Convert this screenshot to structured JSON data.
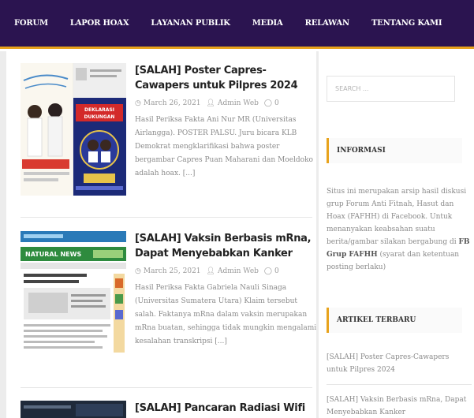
{
  "nav": {
    "items": [
      "FORUM",
      "LAPOR HOAX",
      "LAYANAN PUBLIK",
      "MEDIA",
      "RELAWAN",
      "TENTANG KAMI"
    ]
  },
  "posts": [
    {
      "title": "[SALAH] Poster Capres-Cawapers untuk Pilpres 2024",
      "date": "March 26, 2021",
      "author": "Admin Web",
      "comments": "0",
      "excerpt": "Hasil Periksa Fakta Ani Nur MR (Universitas Airlangga). POSTER PALSU. Juru bicara KLB Demokrat mengklarifikasi bahwa poster bergambar Capres Puan Maharani dan Moeldoko adalah hoax. [...]",
      "thumb_text": "DEKLARASI DUKUNGAN"
    },
    {
      "title": "[SALAH] Vaksin Berbasis mRna, Dapat Menyebabkan Kanker",
      "date": "March 25, 2021",
      "author": "Admin Web",
      "comments": "0",
      "excerpt": "Hasil Periksa Fakta Gabriela Nauli Sinaga (Universitas Sumatera Utara) Klaim tersebut salah. Faktanya mRna dalam vaksin merupakan mRna buatan, sehingga tidak mungkin mengalami kesalahan transkripsi [...]",
      "thumb_text": "NATURAL NEWS"
    },
    {
      "title": "[SALAH] Pancaran Radiasi Wifi Berakibat"
    }
  ],
  "sidebar": {
    "search_placeholder": "SEARCH ...",
    "info_title": "INFORMASI",
    "info_text_1": "Situs ini merupakan arsip hasil diskusi grup Forum Anti Fitnah, Hasut dan Hoax (FAFHH) di Facebook. Untuk menanyakan keabsahan suatu berita/gambar silakan bergabung di ",
    "info_text_bold": "FB Grup FAFHH",
    "info_text_2": " (syarat dan ketentuan posting berlaku)",
    "latest_title": "ARTIKEL TERBARU",
    "latest_items": [
      "[SALAH] Poster Capres-Cawapers untuk Pilpres 2024",
      "[SALAH] Vaksin Berbasis mRna, Dapat Menyebabkan Kanker"
    ]
  },
  "colors": {
    "nav_bg": "#2b1450",
    "accent": "#e8a31c"
  }
}
